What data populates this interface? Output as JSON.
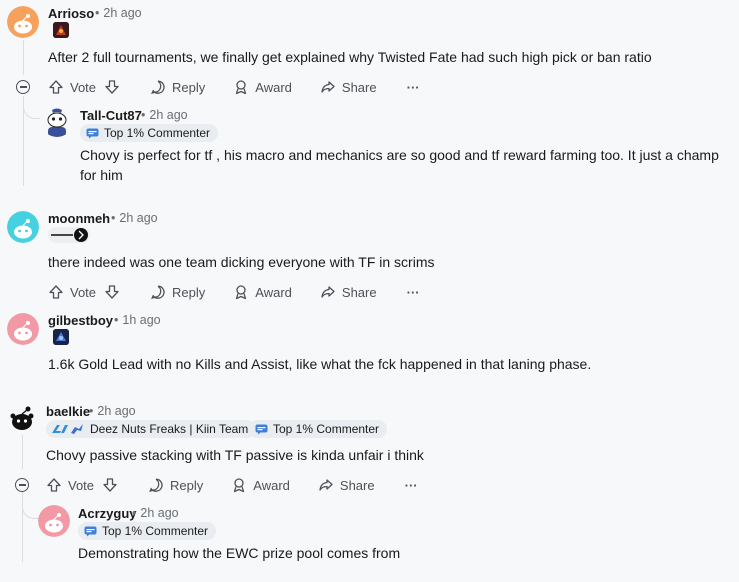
{
  "comments": [
    {
      "username": "Arrioso",
      "time": "2h ago",
      "text": "After 2 full tournaments, we finally get explained why Twisted Fate had such high pick or ban ratio",
      "avatar_color": "#f7a25c"
    },
    {
      "username": "Tall-Cut87",
      "time": "2h ago",
      "badge": "Top 1% Commenter",
      "text": "Chovy is perfect for tf , his macro and mechanics are so good and tf reward farming too. It just a champ for him"
    },
    {
      "username": "moonmeh",
      "time": "2h ago",
      "text": "there indeed was one team dicking everyone with TF in scrims",
      "avatar_color": "#46d1e0"
    },
    {
      "username": "gilbestboy",
      "time": "1h ago",
      "text": "1.6k Gold Lead with no Kills and Assist, like what the fck happened in that laning phase.",
      "avatar_color": "#f19aa6"
    },
    {
      "username": "baelkie",
      "time": "2h ago",
      "flair": "Deez Nuts Freaks | Kiin Team",
      "badge": "Top 1% Commenter",
      "text": "Chovy passive stacking with TF passive is kinda unfair i think"
    },
    {
      "username": "Acrzyguy",
      "time": "2h ago",
      "badge": "Top 1% Commenter",
      "text": "Demonstrating how the EWC prize pool comes from",
      "avatar_color": "#f19aa6"
    }
  ],
  "actions": {
    "vote": "Vote",
    "reply": "Reply",
    "award": "Award",
    "share": "Share",
    "more": "···"
  },
  "colors": {
    "background": "#f7f8fa",
    "meta_text": "#6a6e72",
    "badge_bg": "#e9edf1",
    "thread_line": "#dadde1"
  }
}
